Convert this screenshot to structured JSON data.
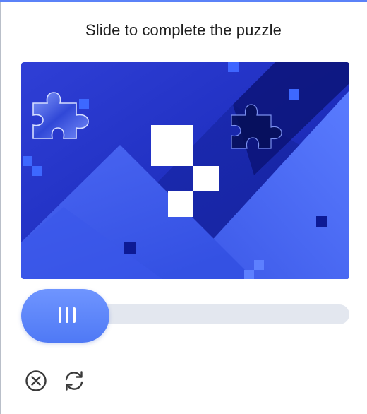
{
  "captcha": {
    "title": "Slide to complete the puzzle",
    "slider": {
      "progress": 0
    },
    "actions": {
      "close_icon": "close-circle-icon",
      "refresh_icon": "refresh-icon"
    }
  },
  "colors": {
    "accent": "#5b82f8",
    "image_dark": "#0f1f9c",
    "image_mid": "#2a44e0",
    "image_light": "#4e6ff5",
    "track": "#e3e7ef",
    "title_text": "#1f1f1f",
    "icon_gray": "#3a3a3a"
  }
}
